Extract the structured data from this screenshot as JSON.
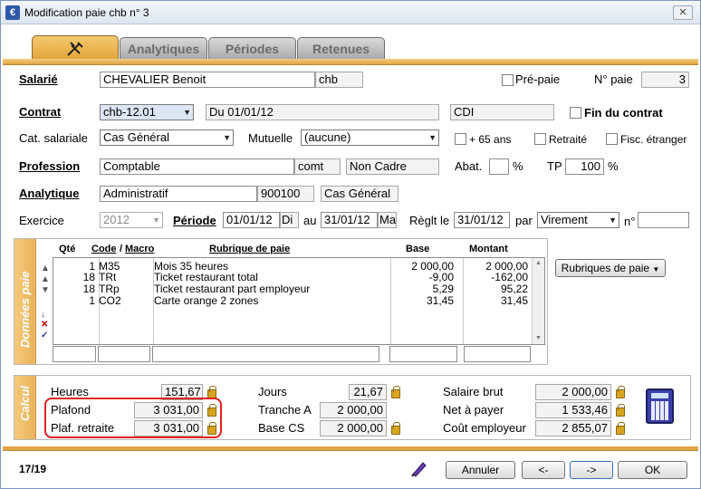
{
  "window": {
    "title": "Modification paie chb n° 3",
    "icon": "app-icon",
    "close_label": "✕"
  },
  "tabs": [
    {
      "label": "",
      "icon": "tools-icon",
      "active": true
    },
    {
      "label": "Analytiques"
    },
    {
      "label": "Périodes"
    },
    {
      "label": "Retenues"
    }
  ],
  "salarie": {
    "label": "Salarié",
    "name": "CHEVALIER Benoit",
    "code": "chb",
    "prepaie_label": "Pré-paie",
    "npaie_label": "N° paie",
    "npaie_value": "3"
  },
  "contrat": {
    "label": "Contrat",
    "value": "chb-12.01",
    "du": "Du 01/01/12",
    "type": "CDI",
    "fin_label": "Fin du contrat"
  },
  "cat": {
    "label": "Cat. salariale",
    "value": "Cas Général",
    "mutuelle_label": "Mutuelle",
    "mutuelle_value": "(aucune)",
    "plus65_label": "+ 65 ans",
    "retraite_label": "Retraité",
    "fisc_label": "Fisc. étranger"
  },
  "profession": {
    "label": "Profession",
    "value": "Comptable",
    "code": "comt",
    "statut": "Non Cadre",
    "abat_label": "Abat.",
    "abat_value": "",
    "pct1": "%",
    "tp_label": "TP",
    "tp_value": "100",
    "pct2": "%"
  },
  "analytique": {
    "label": "Analytique",
    "value": "Administratif",
    "code": "900100",
    "cat": "Cas Général"
  },
  "exercice": {
    "label": "Exercice",
    "value": "2012",
    "periode_label": "Période",
    "du": "01/01/12",
    "du_day": "Di",
    "au_label": "au",
    "au": "31/01/12",
    "au_day": "Ma",
    "reglt_label": "Règlt le",
    "reglt": "31/01/12",
    "par_label": "par",
    "par_value": "Virement",
    "no_label": "n°",
    "no_value": ""
  },
  "donnees": {
    "side_label": "Données paie",
    "headers": {
      "qte": "Qté",
      "code": "Code",
      "slash": "/",
      "macro": "Macro",
      "rubrique": "Rubrique de paie",
      "base": "Base",
      "montant": "Montant"
    },
    "rows": [
      {
        "qte": "1",
        "code": "M35",
        "rubrique": "Mois 35 heures",
        "base": "2 000,00",
        "montant": "2 000,00"
      },
      {
        "qte": "18",
        "code": "TRt",
        "rubrique": "Ticket restaurant total",
        "base": "-9,00",
        "montant": "-162,00"
      },
      {
        "qte": "18",
        "code": "TRp",
        "rubrique": "Ticket restaurant part employeur",
        "base": "5,29",
        "montant": "95,22"
      },
      {
        "qte": "1",
        "code": "CO2",
        "rubrique": "Carte orange 2 zones",
        "base": "31,45",
        "montant": "31,45"
      }
    ],
    "rubriques_button": "Rubriques de paie"
  },
  "calcul": {
    "side_label": "Calcul",
    "heures_label": "Heures",
    "heures": "151,67",
    "plafond_label": "Plafond",
    "plafond": "3 031,00",
    "plaf_retraite_label": "Plaf. retraite",
    "plaf_retraite": "3 031,00",
    "jours_label": "Jours",
    "jours": "21,67",
    "tranche_label": "Tranche A",
    "tranche": "2 000,00",
    "basecs_label": "Base CS",
    "basecs": "2 000,00",
    "brut_label": "Salaire brut",
    "brut": "2 000,00",
    "net_label": "Net à payer",
    "net": "1 533,46",
    "cout_label": "Coût employeur",
    "cout": "2 855,07"
  },
  "footer": {
    "counter": "17/19",
    "annuler": "Annuler",
    "prev": "<-",
    "next": "->",
    "ok": "OK"
  },
  "colors": {
    "accent": "#e0a544",
    "highlight": "#e02020"
  }
}
